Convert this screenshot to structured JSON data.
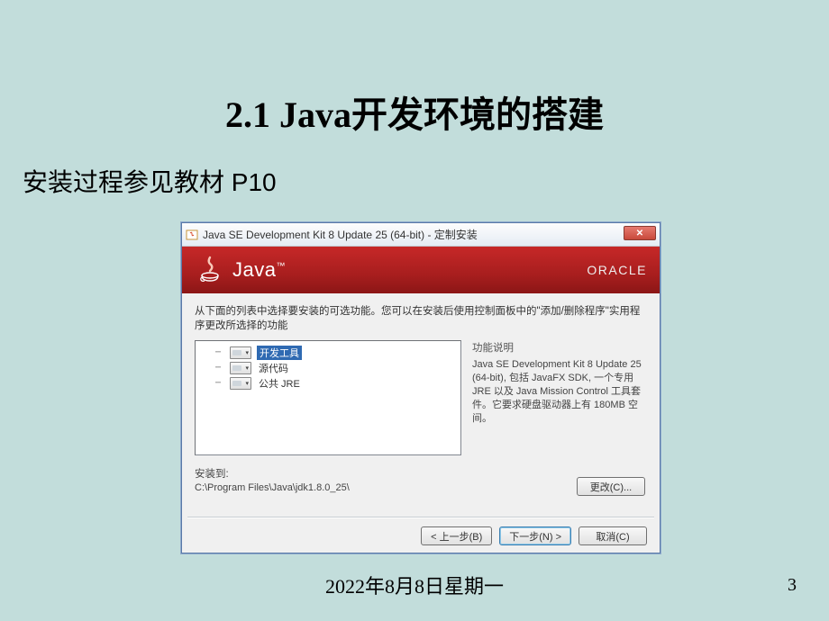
{
  "slide": {
    "title": "2.1  Java开发环境的搭建",
    "subtitle": "安装过程参见教材 P10",
    "footer_date": "2022年8月8日星期一",
    "page_number": "3"
  },
  "installer": {
    "titlebar_icon": "java-box-icon",
    "titlebar_text": "Java SE Development Kit 8 Update 25 (64-bit) - 定制安装",
    "close_label": "✕",
    "banner": {
      "java_logo_text": "Java",
      "tm": "™",
      "oracle": "ORACLE"
    },
    "instruction": "从下面的列表中选择要安装的可选功能。您可以在安装后使用控制面板中的\"添加/删除程序\"实用程序更改所选择的功能",
    "features": [
      {
        "label": "开发工具",
        "selected": true
      },
      {
        "label": "源代码",
        "selected": false
      },
      {
        "label": "公共 JRE",
        "selected": false
      }
    ],
    "desc_title": "功能说明",
    "desc_text": "Java SE Development Kit 8 Update 25 (64-bit), 包括 JavaFX SDK, 一个专用 JRE 以及 Java Mission Control 工具套件。它要求硬盘驱动器上有 180MB 空间。",
    "install_to_label": "安装到:",
    "install_path": "C:\\Program Files\\Java\\jdk1.8.0_25\\",
    "buttons": {
      "change": "更改(C)...",
      "back": "< 上一步(B)",
      "next": "下一步(N) >",
      "cancel": "取消(C)"
    }
  }
}
